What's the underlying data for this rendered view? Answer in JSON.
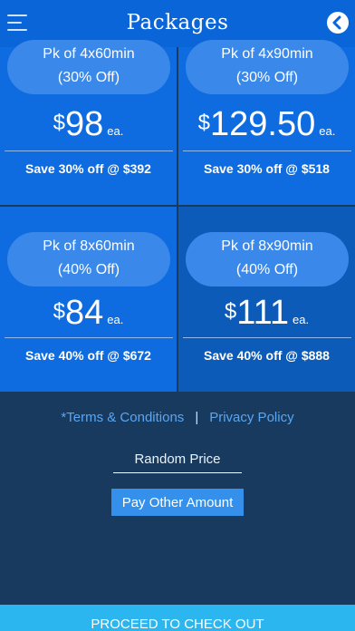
{
  "header": {
    "title": "Packages",
    "menu_icon": "hamburger-menu-icon",
    "back_icon": "chevron-left-circle-icon"
  },
  "packages": [
    {
      "name": "Pk of 4x60min",
      "discount": "(30% Off)",
      "currency": "$",
      "price": "98",
      "unit": "ea.",
      "save": "Save 30% off @ $392",
      "selected": false
    },
    {
      "name": "Pk of 4x90min",
      "discount": "(30% Off)",
      "currency": "$",
      "price": "129.50",
      "unit": "ea.",
      "save": "Save 30% off @ $518",
      "selected": false
    },
    {
      "name": "Pk of 8x60min",
      "discount": "(40% Off)",
      "currency": "$",
      "price": "84",
      "unit": "ea.",
      "save": "Save 40% off @ $672",
      "selected": false
    },
    {
      "name": "Pk of 8x90min",
      "discount": "(40% Off)",
      "currency": "$",
      "price": "111",
      "unit": "ea.",
      "save": "Save 40% off @ $888",
      "selected": true
    }
  ],
  "links": {
    "terms": "*Terms & Conditions",
    "separator": "|",
    "privacy": "Privacy Policy"
  },
  "random_price": {
    "placeholder": "Random Price",
    "value": ""
  },
  "pay_other_label": "Pay Other Amount",
  "checkout_label": "PROCEED TO CHECK OUT",
  "colors": {
    "header": "#0a66d8",
    "card": "#0e6ce0",
    "card_selected": "#0d5bb8",
    "background": "#173a5e",
    "checkout": "#2bb6f0",
    "link": "#5aa6f2"
  }
}
